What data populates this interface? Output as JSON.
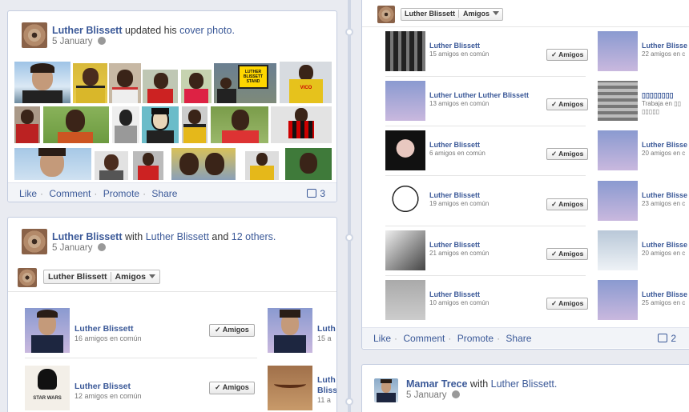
{
  "colors": {
    "link": "#3b5998",
    "bg": "#e9ebf1"
  },
  "post1": {
    "author": "Luther Blissett",
    "verb": "updated his",
    "object": "cover photo.",
    "date": "5 January",
    "actions": [
      "Like",
      "Comment",
      "Promote",
      "Share"
    ],
    "likes": "3",
    "photo_labels": [
      "LUTHER BLISSETT STAND",
      "WATFORD",
      "VICO"
    ]
  },
  "post2": {
    "author": "Luther Blissett",
    "with_word": "with",
    "with_name": "Luther Blissett",
    "and_word": "and",
    "others": "12 others.",
    "date": "5 January",
    "tag_name": "Luther Blissett",
    "tag_rel": "Amigos",
    "friends": [
      {
        "name": "Luther Blissett",
        "mutual": "16 amigos en común",
        "button": "Amigos"
      },
      {
        "name": "Luther Blisset",
        "mutual": "12 amigos en común",
        "button": "Amigos"
      }
    ],
    "clipped": [
      {
        "name": "Luth",
        "mutual": "15 a"
      },
      {
        "name": "Luth",
        "extra": "Bliss",
        "mutual": "11 a"
      }
    ],
    "poster_text": "STAR WARS"
  },
  "post3": {
    "tag_name": "Luther Blissett",
    "tag_rel": "Amigos",
    "friends": [
      {
        "name": "Luther Blissett",
        "mutual": "15 amigos en común",
        "button": "Amigos"
      },
      {
        "name": "Luther Luther Luther Blissett",
        "mutual": "13 amigos en común",
        "button": "Amigos"
      },
      {
        "name": "Luther Blissett",
        "mutual": "6 amigos en común",
        "button": "Amigos"
      },
      {
        "name": "Luther Blissett",
        "mutual": "19 amigos en común",
        "button": "Amigos"
      },
      {
        "name": "Luther Blissett",
        "mutual": "21 amigos en común",
        "button": "Amigos"
      },
      {
        "name": "Luther Blissett",
        "mutual": "10 amigos en común",
        "button": "Amigos"
      }
    ],
    "right_col": [
      {
        "name": "Luther Blisse",
        "mutual": "22 amigos en c"
      },
      {
        "name": "▯▯▯▯▯▯▯▯",
        "mutual": "Trabaja en ▯▯",
        "extra": "▯▯▯▯▯"
      },
      {
        "name": "Luther Blisse",
        "mutual": "20 amigos en c"
      },
      {
        "name": "Luther Blisse",
        "mutual": "23 amigos en c"
      },
      {
        "name": "Luther Blisse",
        "mutual": "20 amigos en c"
      },
      {
        "name": "Luther Blisse",
        "mutual": "25 amigos en c"
      }
    ],
    "actions": [
      "Like",
      "Comment",
      "Promote",
      "Share"
    ],
    "likes": "2"
  },
  "post4": {
    "author": "Mamar Trece",
    "with_word": "with",
    "with_name": "Luther Blissett.",
    "date": "5 January"
  }
}
